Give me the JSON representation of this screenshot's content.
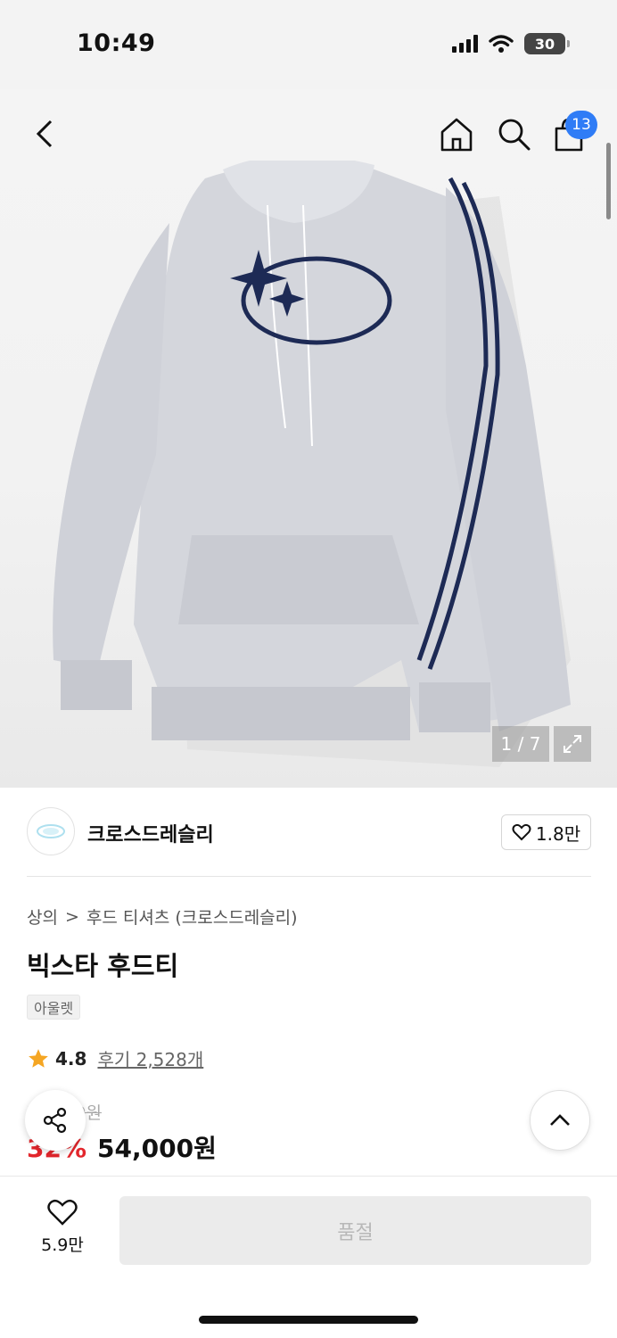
{
  "status_bar": {
    "time": "10:49",
    "battery": "30"
  },
  "header": {
    "cart_count": "13"
  },
  "gallery": {
    "page_indicator": "1 / 7"
  },
  "brand": {
    "name": "크로스드레슬리",
    "likes": "1.8만"
  },
  "breadcrumb": {
    "level1": "상의",
    "separator": ">",
    "level2": "후드 티셔츠 (크로스드레슬리)"
  },
  "product": {
    "title": "빅스타 후드티",
    "tag": "아울렛",
    "rating": "4.8",
    "reviews": "후기 2,528개",
    "original_price": "79,000원",
    "discount": "32%",
    "price": "54,000원"
  },
  "bottom_bar": {
    "wish_count": "5.9만",
    "buy_label": "품절"
  },
  "colors": {
    "accent_blue": "#2f7cf6",
    "discount_red": "#e3262c",
    "star": "#f5a623"
  }
}
